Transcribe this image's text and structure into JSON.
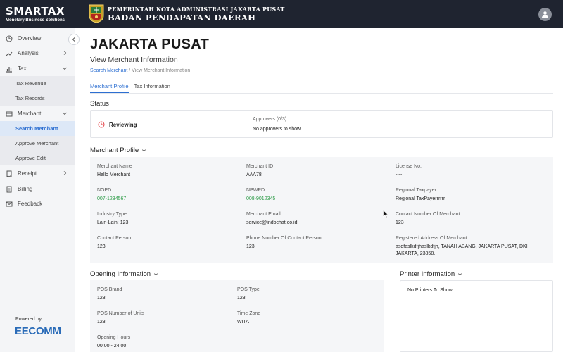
{
  "brand": {
    "name": "SMARTAX",
    "tagline": "Monetary Business Solutions"
  },
  "header": {
    "gov_line1": "PEMERINTAH KOTA ADMINISTRASI JAKARTA PUSAT",
    "gov_line2": "BADAN PENDAPATAN DAERAH",
    "avatar_icon": "user-icon"
  },
  "sidebar": {
    "items": [
      {
        "label": "Overview",
        "icon": "clock-icon"
      },
      {
        "label": "Analysis",
        "icon": "trend-icon"
      },
      {
        "label": "Tax",
        "icon": "bar-chart-icon"
      },
      {
        "label": "Tax Revenue"
      },
      {
        "label": "Tax Records"
      },
      {
        "label": "Merchant",
        "icon": "store-icon"
      },
      {
        "label": "Search Merchant"
      },
      {
        "label": "Approve Merchant"
      },
      {
        "label": "Approve Edit"
      },
      {
        "label": "Receipt",
        "icon": "receipt-icon"
      },
      {
        "label": "Billing",
        "icon": "billing-icon"
      },
      {
        "label": "Feedback",
        "icon": "mail-icon"
      }
    ],
    "powered_by": "Powered by",
    "partner": "EECOMM"
  },
  "page": {
    "title": "JAKARTA PUSAT",
    "subtitle": "View Merchant Information",
    "breadcrumb": {
      "link": "Search Merchant",
      "current": "/ View Merchant Information"
    },
    "tabs": [
      "Merchant Profile",
      "Tax Information"
    ]
  },
  "status": {
    "title": "Status",
    "state": "Reviewing",
    "approvers_label": "Approvers (0/3)",
    "approvers_value": "No approvers to show."
  },
  "merchant_profile": {
    "title": "Merchant Profile",
    "fields": [
      {
        "label": "Merchant Name",
        "value": "Hello Merchant"
      },
      {
        "label": "Merchant ID",
        "value": "AAA78"
      },
      {
        "label": "License No.",
        "value": "----"
      },
      {
        "label": "NOPD",
        "value": "007-1234567"
      },
      {
        "label": "NPWPD",
        "value": "008-9012345"
      },
      {
        "label": "Regional Taxpayer",
        "value": "Regional TaxPayerrrrrr"
      },
      {
        "label": "Industry Type",
        "value": "Lain-Lain: 123"
      },
      {
        "label": "Merchant Email",
        "value": "service@indochat.co.id"
      },
      {
        "label": "Contact Number Of Merchant",
        "value": "123"
      },
      {
        "label": "Contact Person",
        "value": "123"
      },
      {
        "label": "Phone Number Of Contact Person",
        "value": "123"
      },
      {
        "label": "Registered Address Of Merchant",
        "value": "asdfaslkdfjhaslkdfjh, TANAH ABANG, JAKARTA PUSAT, DKI JAKARTA, 23858."
      }
    ]
  },
  "opening_info": {
    "title": "Opening Information",
    "fields": [
      {
        "label": "POS Brand",
        "value": "123"
      },
      {
        "label": "POS Type",
        "value": "123"
      },
      {
        "label": "POS Number of Units",
        "value": "123"
      },
      {
        "label": "Time Zone",
        "value": "WITA"
      },
      {
        "label": "Opening Hours",
        "value": "00:00 - 24:00"
      }
    ]
  },
  "printer_info": {
    "title": "Printer Information",
    "empty": "No Printers To Show."
  },
  "colors": {
    "accent": "#2d6fd1",
    "header": "#1f2430",
    "success": "#2e9c48",
    "warning": "#e5484d"
  }
}
